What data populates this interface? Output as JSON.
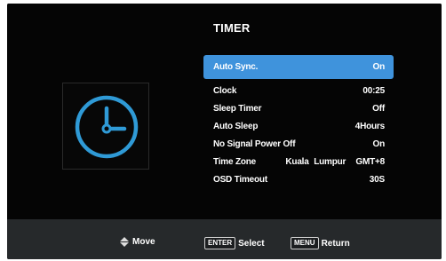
{
  "header": {
    "title": "TIMER"
  },
  "icon": {
    "name": "clock-icon",
    "color": "#2f9ad6"
  },
  "menu": {
    "items": [
      {
        "label": "Auto Sync.",
        "value": "On",
        "selected": true
      },
      {
        "label": "Clock",
        "value": "00:25"
      },
      {
        "label": "Sleep Timer",
        "value": "Off"
      },
      {
        "label": "Auto Sleep",
        "value": "4Hours"
      },
      {
        "label": "No Signal Power Off",
        "value": "On"
      },
      {
        "label": "Time Zone",
        "value": "Kuala Lumpur  GMT+8"
      },
      {
        "label": "OSD Timeout",
        "value": "30S"
      }
    ]
  },
  "footer": {
    "move_label": "Move",
    "enter_key": "ENTER",
    "select_label": "Select",
    "menu_key": "MENU",
    "return_label": "Return"
  },
  "colors": {
    "accent": "#3f93dc",
    "background": "#050505",
    "footer": "#26292b"
  }
}
